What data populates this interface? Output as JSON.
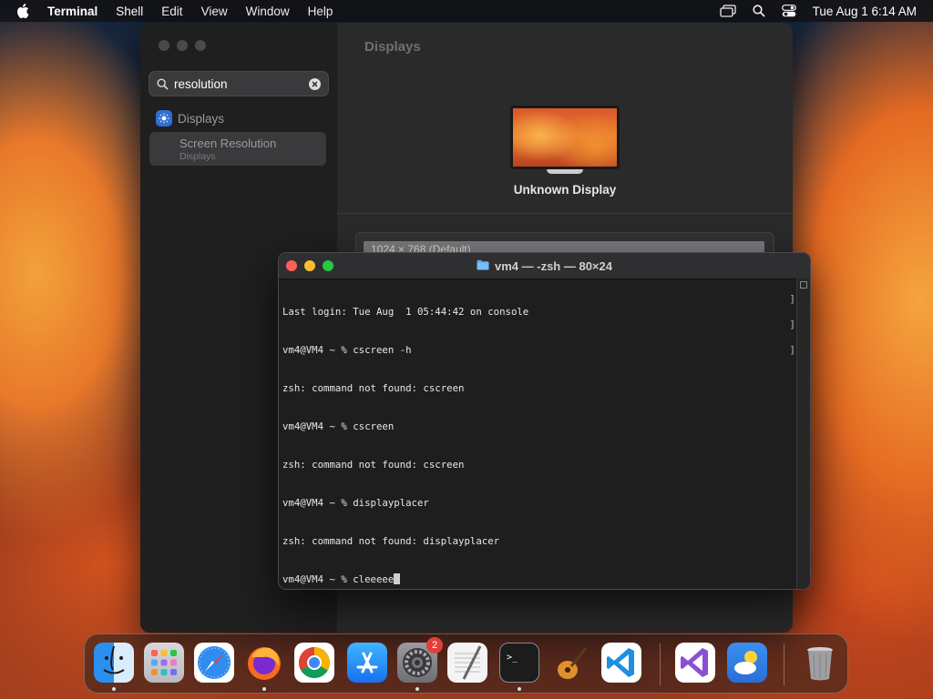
{
  "menubar": {
    "app_name": "Terminal",
    "items": [
      "Shell",
      "Edit",
      "View",
      "Window",
      "Help"
    ],
    "clock": "Tue Aug 1  6:14 AM"
  },
  "settings": {
    "search_value": "resolution",
    "sidebar_section": "Displays",
    "result_title": "Screen Resolution",
    "result_subtitle": "Displays",
    "main_title": "Displays",
    "display_name": "Unknown Display",
    "resolution_row": "1024 × 768 (Default)"
  },
  "terminal": {
    "title": "vm4 — -zsh — 80×24",
    "lines": [
      "Last login: Tue Aug  1 05:44:42 on console",
      "vm4@VM4 ~ % cscreen -h",
      "zsh: command not found: cscreen",
      "vm4@VM4 ~ % cscreen",
      "zsh: command not found: cscreen",
      "vm4@VM4 ~ % displayplacer",
      "zsh: command not found: displayplacer",
      "vm4@VM4 ~ % cleeeee"
    ]
  },
  "dock": {
    "apps": [
      "finder",
      "launchpad",
      "safari",
      "firefox",
      "chrome",
      "app-store",
      "system-settings",
      "textedit",
      "terminal",
      "garageband",
      "vscode",
      "visual-studio",
      "weather",
      "trash"
    ],
    "settings_badge": "2"
  },
  "colors": {
    "close": "#ff5f57",
    "minimize": "#febc2e",
    "zoom": "#28c840",
    "badge": "#e0403a"
  }
}
